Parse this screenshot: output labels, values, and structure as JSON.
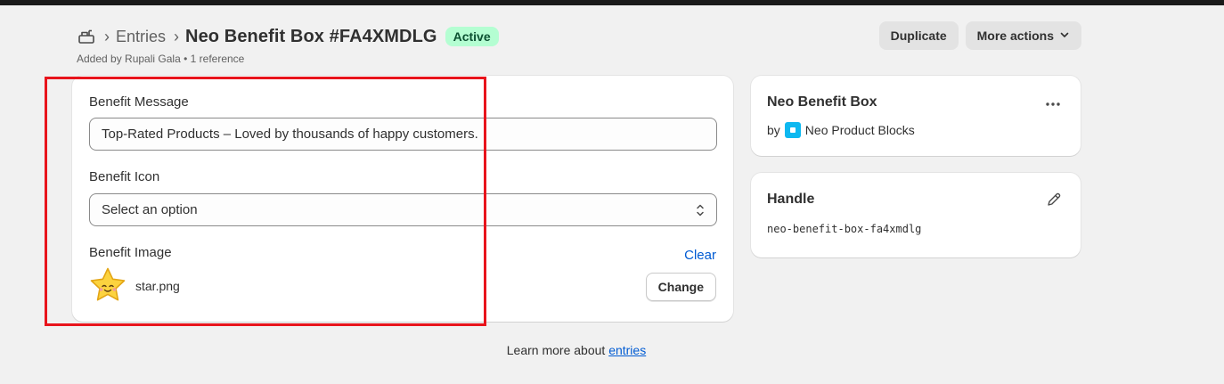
{
  "breadcrumb": {
    "section": "Entries"
  },
  "page": {
    "title": "Neo Benefit Box #FA4XMDLG",
    "status": "Active",
    "added_by": "Added by Rupali Gala",
    "references": "1 reference"
  },
  "actions": {
    "duplicate": "Duplicate",
    "more": "More actions"
  },
  "form": {
    "message_label": "Benefit Message",
    "message_value": "Top-Rated Products – Loved by thousands of happy customers.",
    "icon_label": "Benefit Icon",
    "icon_value": "Select an option",
    "image_label": "Benefit Image",
    "clear": "Clear",
    "filename": "star.png",
    "change": "Change"
  },
  "definition": {
    "title": "Neo Benefit Box",
    "by": "by",
    "app": "Neo Product Blocks"
  },
  "handle": {
    "title": "Handle",
    "value": "neo-benefit-box-fa4xmdlg"
  },
  "footer": {
    "text": "Learn more about",
    "link": "entries"
  },
  "icons": {
    "entries": "entries-icon",
    "chevron": "chevron-down-icon",
    "select": "select-arrows-icon",
    "star": "star-icon",
    "menu": "more-dots-icon",
    "edit": "pencil-icon",
    "app": "app-logo-icon"
  },
  "colors": {
    "accent": "#005bd3",
    "badge_bg": "#b4fed2",
    "badge_text": "#0c5132",
    "highlight": "#e8141c",
    "app_logo": "#0db8f0"
  }
}
